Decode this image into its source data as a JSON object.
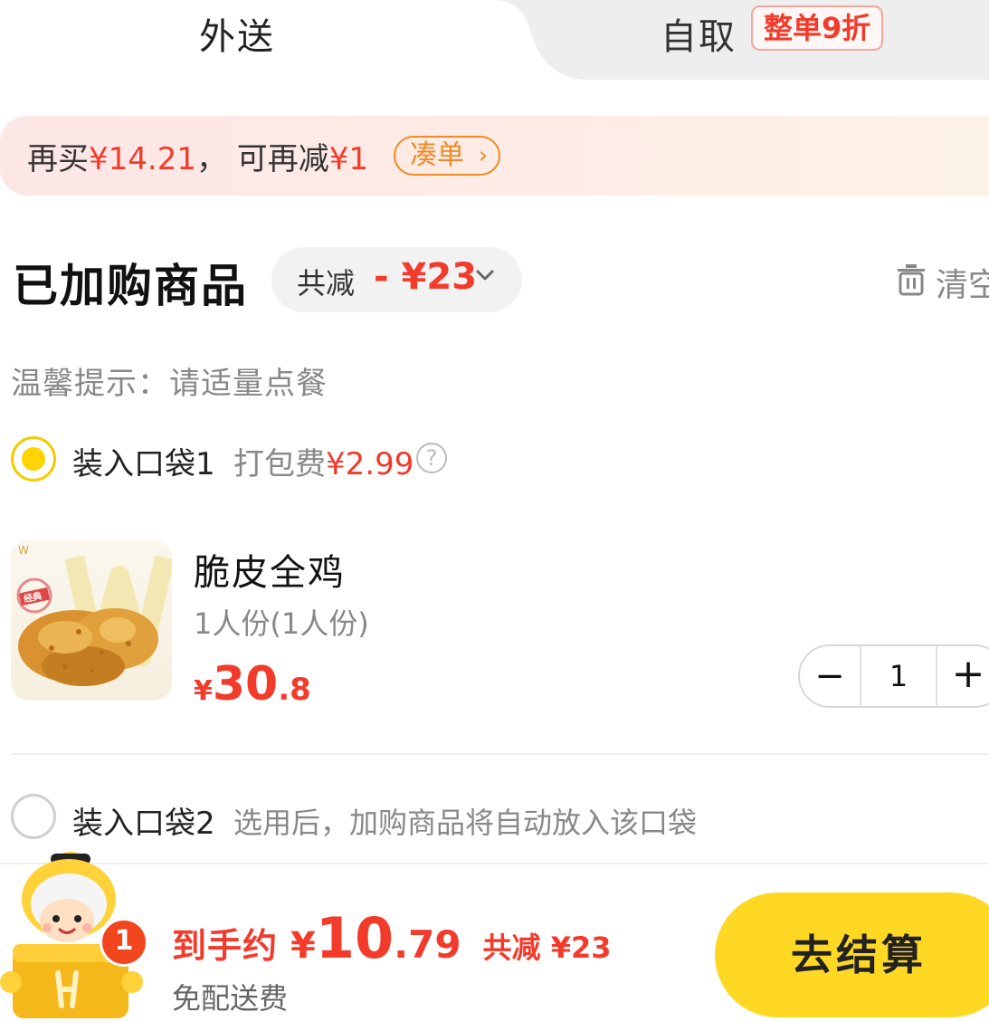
{
  "tabs": {
    "delivery_label": "外送",
    "pickup_label": "自取",
    "pickup_badge": "整单9折"
  },
  "promo": {
    "prefix": "再买",
    "amount": "¥14.21",
    "sep": "，",
    "middle": "可再减",
    "discount": "¥1",
    "button_label": "凑单"
  },
  "cart": {
    "title": "已加购商品",
    "discount_label": "共减",
    "discount_value": "- ¥23",
    "clear_label": "清空",
    "tip": "温馨提示：请适量点餐"
  },
  "bag1": {
    "label": "装入口袋1",
    "fee_label": "打包费",
    "fee_value": "¥2.99",
    "selected": true
  },
  "product": {
    "name": "脆皮全鸡",
    "spec": "1人份(1人份)",
    "price_currency": "¥",
    "price_integer": "30",
    "price_decimal": ".8",
    "quantity": "1",
    "image_badge": "经典"
  },
  "bag2": {
    "label": "装入口袋2",
    "note": "选用后，加购商品将自动放入该口袋",
    "selected": false
  },
  "footer": {
    "cart_count": "1",
    "total_label": "到手约",
    "total_currency": "¥",
    "total_integer": "10",
    "total_decimal": ".79",
    "total_saved": "共减 ¥23",
    "shipping_note": "免配送费",
    "checkout_label": "去结算"
  },
  "colors": {
    "accent_red": "#f23b2b",
    "accent_yellow": "#ffd823",
    "promo_orange": "#f08a24"
  }
}
